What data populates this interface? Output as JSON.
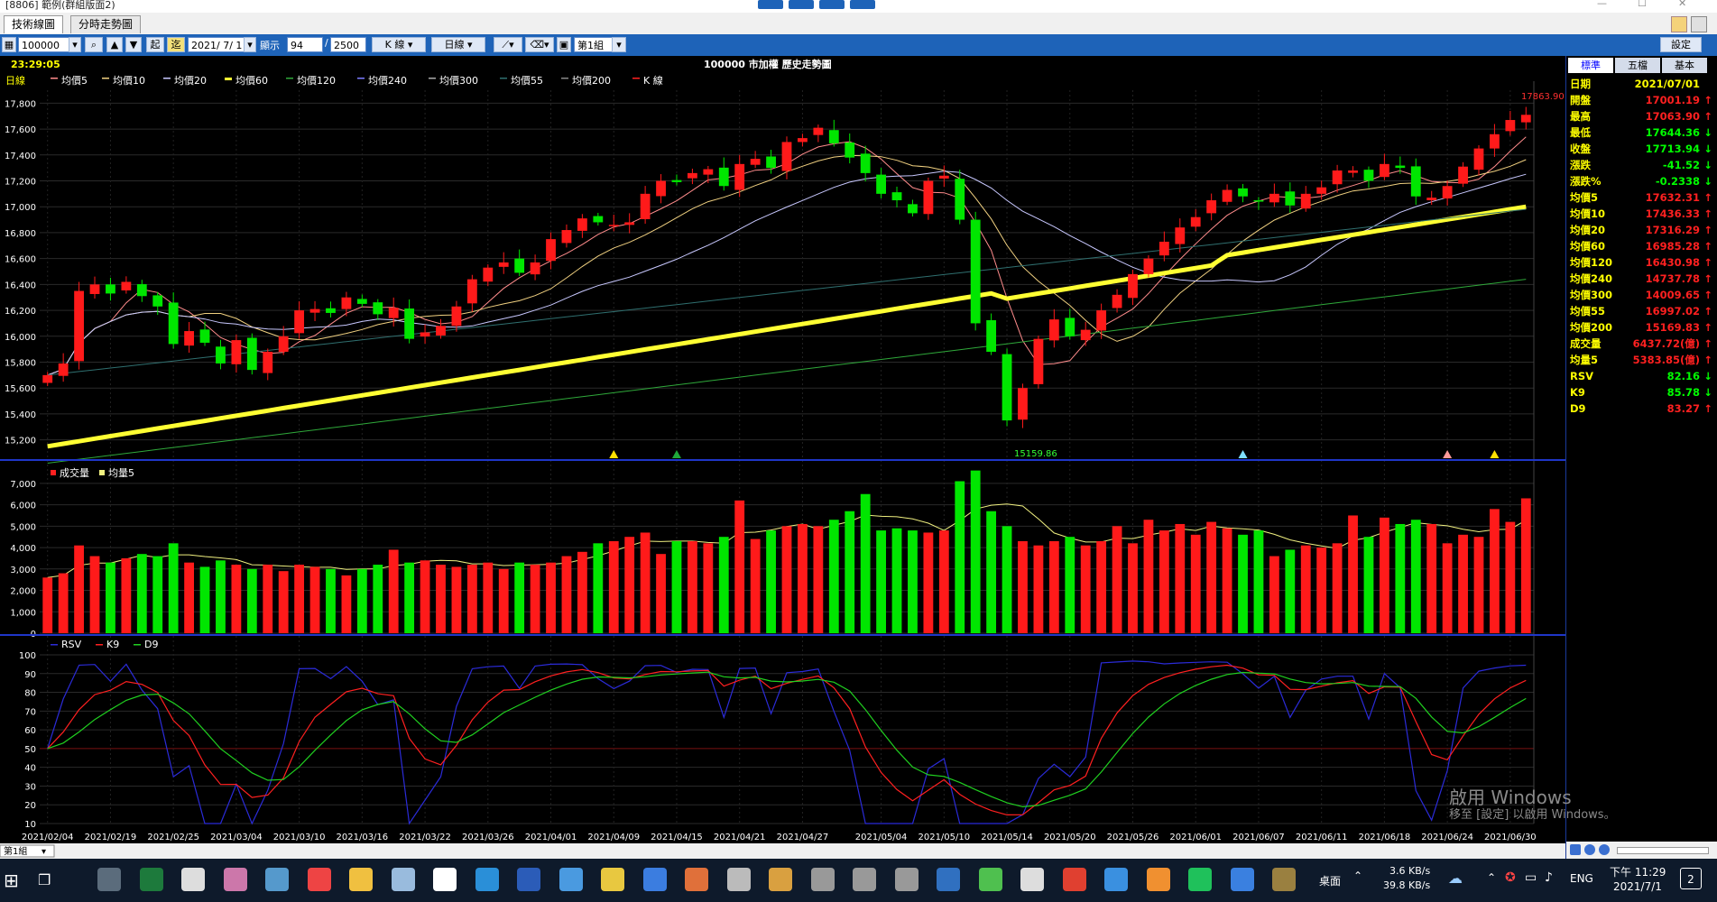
{
  "window": {
    "title": "[8806] 範例(群組版面2)"
  },
  "tabs": [
    {
      "label": "技術線圖"
    },
    {
      "label": "分時走勢圖"
    }
  ],
  "toolbar": {
    "symbol": "100000",
    "start_label": "起",
    "end_label": "迄",
    "date": "2021/ 7/ 1",
    "show_label": "顯示",
    "show_count": "94",
    "total": "2500",
    "chart_type": "K 線",
    "period": "日線",
    "group": "第1組",
    "settings": "設定"
  },
  "chart_header": {
    "time": "23:29:05",
    "title": "100000 市加權  歷史走勢圖",
    "period_label": "日線"
  },
  "legend_main": [
    "均價5",
    "均價10",
    "均價20",
    "均價60",
    "均價120",
    "均價240",
    "均價300",
    "均價55",
    "均價200",
    "K 線"
  ],
  "legend_volume": [
    "成交量",
    "均量5"
  ],
  "legend_kd": [
    "RSV",
    "K9",
    "D9"
  ],
  "annotations": {
    "high": "17863.90",
    "low": "15159.86"
  },
  "colors": {
    "up": "#ff1a1a",
    "down": "#00e600",
    "ma60": "#ffff33",
    "background": "#000000",
    "grid": "#333333"
  },
  "right_panel": {
    "tabs": [
      "標準",
      "五檔",
      "基本"
    ],
    "rows": [
      {
        "label": "日期",
        "value": "2021/07/01",
        "color": "#ffff00",
        "arrow": ""
      },
      {
        "label": "開盤",
        "value": "17001.19",
        "color": "#ff2020",
        "arrow": "↑"
      },
      {
        "label": "最高",
        "value": "17063.90",
        "color": "#ff2020",
        "arrow": "↑"
      },
      {
        "label": "最低",
        "value": "17644.36",
        "color": "#00ff00",
        "arrow": "↓"
      },
      {
        "label": "收盤",
        "value": "17713.94",
        "color": "#00ff00",
        "arrow": "↓"
      },
      {
        "label": "漲跌",
        "value": "-41.52",
        "color": "#00ff00",
        "arrow": "↓"
      },
      {
        "label": "漲跌%",
        "value": "-0.2338",
        "color": "#00ff00",
        "arrow": "↓"
      },
      {
        "label": "均價5",
        "value": "17632.31",
        "color": "#ff2020",
        "arrow": "↑"
      },
      {
        "label": "均價10",
        "value": "17436.33",
        "color": "#ff2020",
        "arrow": "↑"
      },
      {
        "label": "均價20",
        "value": "17316.29",
        "color": "#ff2020",
        "arrow": "↑"
      },
      {
        "label": "均價60",
        "value": "16985.28",
        "color": "#ff2020",
        "arrow": "↑"
      },
      {
        "label": "均價120",
        "value": "16430.98",
        "color": "#ff2020",
        "arrow": "↑"
      },
      {
        "label": "均價240",
        "value": "14737.78",
        "color": "#ff2020",
        "arrow": "↑"
      },
      {
        "label": "均價300",
        "value": "14009.65",
        "color": "#ff2020",
        "arrow": "↑"
      },
      {
        "label": "均價55",
        "value": "16997.02",
        "color": "#ff2020",
        "arrow": "↑"
      },
      {
        "label": "均價200",
        "value": "15169.83",
        "color": "#ff2020",
        "arrow": "↑"
      },
      {
        "label": "成交量",
        "value": "6437.72(億)",
        "color": "#ff2020",
        "arrow": "↑"
      },
      {
        "label": "均量5",
        "value": "5383.85(億)",
        "color": "#ff2020",
        "arrow": "↑"
      },
      {
        "label": "RSV",
        "value": "82.16",
        "color": "#00ff00",
        "arrow": "↓"
      },
      {
        "label": "K9",
        "value": "85.78",
        "color": "#00ff00",
        "arrow": "↓"
      },
      {
        "label": "D9",
        "value": "83.27",
        "color": "#ff2020",
        "arrow": "↑"
      }
    ]
  },
  "watermark": {
    "line1": "啟用 Windows",
    "line2": "移至 [設定] 以啟用 Windows。"
  },
  "taskbar": {
    "desktop": "桌面",
    "net_up": "3.6 KB/s",
    "net_down": "39.8 KB/s",
    "lang": "ENG",
    "time": "下午 11:29",
    "date": "2021/7/1",
    "notif": "2"
  },
  "bottom_group": "第1組",
  "chart_data": {
    "type": "candlestick",
    "dates": [
      "2021/02/04",
      "2021/02/05",
      "2021/02/17",
      "2021/02/18",
      "2021/02/19",
      "2021/02/22",
      "2021/02/23",
      "2021/02/24",
      "2021/02/25",
      "2021/02/26",
      "2021/03/02",
      "2021/03/03",
      "2021/03/04",
      "2021/03/05",
      "2021/03/08",
      "2021/03/09",
      "2021/03/10",
      "2021/03/11",
      "2021/03/12",
      "2021/03/15",
      "2021/03/16",
      "2021/03/17",
      "2021/03/18",
      "2021/03/19",
      "2021/03/22",
      "2021/03/23",
      "2021/03/24",
      "2021/03/25",
      "2021/03/26",
      "2021/03/29",
      "2021/03/30",
      "2021/03/31",
      "2021/04/01",
      "2021/04/06",
      "2021/04/07",
      "2021/04/08",
      "2021/04/09",
      "2021/04/12",
      "2021/04/13",
      "2021/04/14",
      "2021/04/15",
      "2021/04/16",
      "2021/04/19",
      "2021/04/20",
      "2021/04/21",
      "2021/04/22",
      "2021/04/23",
      "2021/04/26",
      "2021/04/27",
      "2021/04/28",
      "2021/04/29",
      "2021/04/30",
      "2021/05/03",
      "2021/05/04",
      "2021/05/05",
      "2021/05/06",
      "2021/05/07",
      "2021/05/10",
      "2021/05/11",
      "2021/05/12",
      "2021/05/13",
      "2021/05/14",
      "2021/05/17",
      "2021/05/18",
      "2021/05/19",
      "2021/05/20",
      "2021/05/21",
      "2021/05/24",
      "2021/05/25",
      "2021/05/26",
      "2021/05/27",
      "2021/05/28",
      "2021/05/31",
      "2021/06/01",
      "2021/06/02",
      "2021/06/03",
      "2021/06/04",
      "2021/06/07",
      "2021/06/08",
      "2021/06/09",
      "2021/06/10",
      "2021/06/11",
      "2021/06/15",
      "2021/06/16",
      "2021/06/17",
      "2021/06/18",
      "2021/06/21",
      "2021/06/22",
      "2021/06/23",
      "2021/06/24",
      "2021/06/25",
      "2021/06/28",
      "2021/06/29",
      "2021/06/30",
      "2021/07/01"
    ],
    "x_tick_labels": [
      "2021/02/04",
      "2021/02/19",
      "2021/02/25",
      "2021/03/04",
      "2021/03/10",
      "2021/03/16",
      "2021/03/22",
      "2021/03/26",
      "2021/04/01",
      "2021/04/09",
      "2021/04/15",
      "2021/04/21",
      "2021/04/27",
      "2021/05/04",
      "2021/05/10",
      "2021/05/14",
      "2021/05/20",
      "2021/05/26",
      "2021/06/01",
      "2021/06/07",
      "2021/06/11",
      "2021/06/18",
      "2021/06/24",
      "2021/06/30"
    ],
    "close": [
      15700,
      15790,
      16350,
      16400,
      16330,
      16420,
      16310,
      16230,
      15940,
      16040,
      15950,
      15790,
      15970,
      15740,
      15880,
      16000,
      16200,
      16210,
      16180,
      16300,
      16250,
      16170,
      16220,
      15980,
      16030,
      16080,
      16230,
      16440,
      16530,
      16570,
      16490,
      16570,
      16750,
      16820,
      16910,
      16880,
      16860,
      16880,
      17100,
      17200,
      17190,
      17260,
      17290,
      17160,
      17330,
      17370,
      17300,
      17500,
      17530,
      17610,
      17490,
      17380,
      17260,
      17100,
      17050,
      16950,
      17200,
      17240,
      16900,
      16100,
      15880,
      15350,
      15600,
      15980,
      16130,
      16000,
      16050,
      16200,
      16320,
      16480,
      16600,
      16730,
      16840,
      16920,
      17050,
      17130,
      17080,
      17040,
      17100,
      17010,
      17100,
      17150,
      17280,
      17280,
      17200,
      17330,
      17300,
      17080,
      17070,
      17160,
      17310,
      17450,
      17560,
      17670,
      17710
    ],
    "volume": [
      2600,
      2800,
      4100,
      3600,
      3300,
      3500,
      3700,
      3600,
      4200,
      3300,
      3100,
      3400,
      3200,
      3000,
      3200,
      2900,
      3200,
      3100,
      3000,
      2700,
      3000,
      3200,
      3900,
      3300,
      3400,
      3200,
      3100,
      3200,
      3300,
      3000,
      3300,
      3200,
      3300,
      3600,
      3800,
      4200,
      4300,
      4500,
      4700,
      3700,
      4300,
      4300,
      4200,
      4500,
      6200,
      4400,
      4800,
      5000,
      5100,
      5000,
      5300,
      5700,
      6500,
      4800,
      4900,
      4800,
      4700,
      4800,
      7100,
      7600,
      5700,
      5000,
      4300,
      4100,
      4300,
      4500,
      4100,
      4300,
      5000,
      4200,
      5300,
      4800,
      5100,
      4600,
      5200,
      4900,
      4600,
      4800,
      3600,
      3900,
      4100,
      4000,
      4200,
      5500,
      4500,
      5400,
      5100,
      5300,
      5100,
      4200,
      4600,
      4500,
      5800,
      5200,
      6300
    ],
    "ylim_price": [
      15100,
      17900
    ],
    "ylim_volume": [
      0,
      7500
    ],
    "ylim_kd": [
      10,
      100
    ],
    "price_ticks": [
      15200,
      15400,
      15600,
      15800,
      16000,
      16200,
      16400,
      16600,
      16800,
      17000,
      17200,
      17400,
      17600,
      17800
    ],
    "volume_ticks": [
      0,
      1000,
      2000,
      3000,
      4000,
      5000,
      6000,
      7000
    ],
    "kd_ticks": [
      10,
      20,
      30,
      40,
      50,
      60,
      70,
      80,
      90,
      100
    ],
    "markers": {
      "yellow": [
        "2021/04/09",
        "2021/06/29"
      ],
      "green": [
        "2021/04/15"
      ],
      "cyan": [
        "2021/06/04"
      ],
      "pink": [
        "2021/06/24"
      ]
    }
  }
}
